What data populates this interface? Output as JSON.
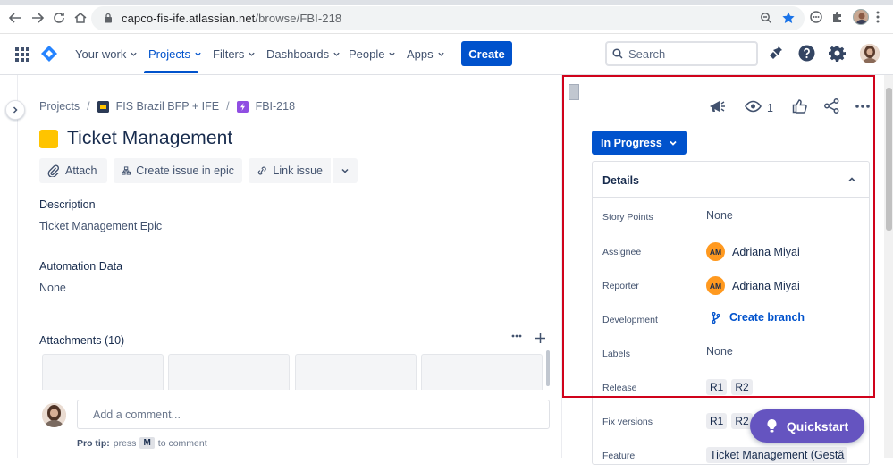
{
  "browser": {
    "url_host": "capco-fis-ife.atlassian.net",
    "url_path": "/browse/FBI-218"
  },
  "nav": {
    "items": [
      {
        "label": "Your work"
      },
      {
        "label": "Projects"
      },
      {
        "label": "Filters"
      },
      {
        "label": "Dashboards"
      },
      {
        "label": "People"
      },
      {
        "label": "Apps"
      }
    ],
    "active": "Projects",
    "create_label": "Create",
    "search_placeholder": "Search",
    "accent": "#0052cc"
  },
  "breadcrumb": {
    "root": "Projects",
    "project": "FIS Brazil BFP + IFE",
    "issue_key": "FBI-218"
  },
  "issue": {
    "title": "Ticket Management",
    "actions": {
      "attach": "Attach",
      "create_in_epic": "Create issue in epic",
      "link_issue": "Link issue"
    },
    "description_label": "Description",
    "description": "Ticket Management Epic",
    "automation_label": "Automation Data",
    "automation_value": "None",
    "attachments_label": "Attachments (10)",
    "comment_placeholder": "Add a comment...",
    "protip_prefix": "Pro tip:",
    "protip_press": "press",
    "protip_key": "M",
    "protip_suffix": "to comment"
  },
  "sidebar": {
    "watch_count": "1",
    "status": "In Progress",
    "details_title": "Details",
    "fields": {
      "story_points": {
        "name": "Story Points",
        "value": "None"
      },
      "assignee": {
        "name": "Assignee",
        "initials": "AM",
        "value": "Adriana Miyai"
      },
      "reporter": {
        "name": "Reporter",
        "initials": "AM",
        "value": "Adriana Miyai"
      },
      "development": {
        "name": "Development",
        "value": "Create branch"
      },
      "labels": {
        "name": "Labels",
        "value": "None"
      },
      "release": {
        "name": "Release",
        "tags": [
          "R1",
          "R2"
        ]
      },
      "fix_versions": {
        "name": "Fix versions",
        "tags": [
          "R1",
          "R2"
        ]
      },
      "feature": {
        "name": "Feature",
        "value": "Ticket Management (Gestã"
      }
    },
    "highlight_color": "#d0021b"
  },
  "quickstart": {
    "label": "Quickstart",
    "color": "#6554c0"
  }
}
